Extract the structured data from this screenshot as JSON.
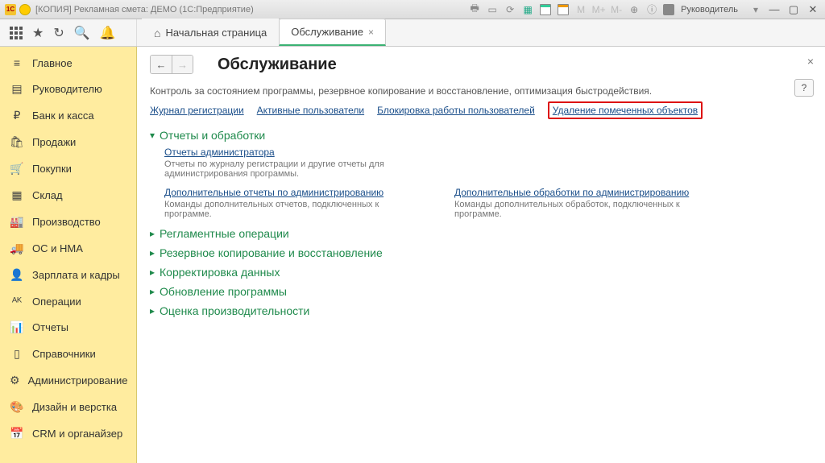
{
  "titlebar": {
    "logo_text": "1C",
    "title": "[КОПИЯ] Рекламная смета: ДЕМО  (1С:Предприятие)",
    "m_labels": [
      "M",
      "M+",
      "M-"
    ],
    "user_label": "Руководитель"
  },
  "tabs": {
    "home": "Начальная страница",
    "active": "Обслуживание"
  },
  "sidebar": {
    "items": [
      {
        "icon": "≡",
        "label": "Главное"
      },
      {
        "icon": "▤",
        "label": "Руководителю"
      },
      {
        "icon": "₽",
        "label": "Банк и касса"
      },
      {
        "icon": "🛍",
        "label": "Продажи"
      },
      {
        "icon": "🛒",
        "label": "Покупки"
      },
      {
        "icon": "▦",
        "label": "Склад"
      },
      {
        "icon": "🏭",
        "label": "Производство"
      },
      {
        "icon": "🚚",
        "label": "ОС и НМА"
      },
      {
        "icon": "👤",
        "label": "Зарплата и кадры"
      },
      {
        "icon": "ᴬᴷ",
        "label": "Операции"
      },
      {
        "icon": "📊",
        "label": "Отчеты"
      },
      {
        "icon": "▯",
        "label": "Справочники"
      },
      {
        "icon": "⚙",
        "label": "Администрирование"
      },
      {
        "icon": "🎨",
        "label": "Дизайн и верстка"
      },
      {
        "icon": "📅",
        "label": "CRM и органайзер"
      }
    ]
  },
  "content": {
    "title": "Обслуживание",
    "desc": "Контроль за состоянием программы, резервное копирование и восстановление, оптимизация быстродействия.",
    "links": {
      "log": "Журнал регистрации",
      "users": "Активные пользователи",
      "lock": "Блокировка работы пользователей",
      "del_marked": "Удаление помеченных объектов"
    },
    "sections": {
      "reports": {
        "title": "Отчеты и обработки",
        "admin_reports_link": "Отчеты администратора",
        "admin_reports_desc": "Отчеты по журналу регистрации и другие отчеты для администрирования программы.",
        "add_reports_link": "Дополнительные отчеты по администрированию",
        "add_reports_desc": "Команды дополнительных отчетов, подключенных к программе.",
        "add_proc_link": "Дополнительные обработки по администрированию",
        "add_proc_desc": "Команды дополнительных обработок, подключенных к программе."
      },
      "scheduled": "Регламентные операции",
      "backup": "Резервное копирование и восстановление",
      "correct": "Корректировка данных",
      "update": "Обновление программы",
      "perf": "Оценка производительности"
    },
    "help": "?"
  }
}
